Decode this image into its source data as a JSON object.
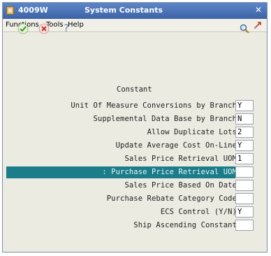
{
  "window": {
    "code": "4009W",
    "title": "System Constants",
    "close_symbol": "✕"
  },
  "menu": {
    "items": [
      "Functions",
      "Tools",
      "Help"
    ]
  },
  "toolbar": {
    "ok_icon": "check-icon",
    "cancel_icon": "cancel-icon",
    "help_label": "?",
    "search_icon": "magnifier-icon"
  },
  "colors": {
    "title_bar": "#4a73b8",
    "selection": "#1b7c8a",
    "background": "#ecebe2"
  },
  "form": {
    "section_title": "Constant",
    "rows": [
      {
        "label": "Unit Of Measure Conversions by Branch",
        "value": "Y"
      },
      {
        "label": "Supplemental Data Base by Branch",
        "value": "N"
      },
      {
        "label": "Allow Duplicate Lots",
        "value": "2"
      },
      {
        "label": "Update Average Cost On-Line",
        "value": "Y"
      },
      {
        "label": "Sales Price Retrieval UOM",
        "value": "1"
      },
      {
        "label": ": Purchase Price Retrieval UOM",
        "value": ""
      },
      {
        "label": "Sales Price Based On Date",
        "value": ""
      },
      {
        "label": "Purchase Rebate Category Code",
        "value": ""
      },
      {
        "label": "ECS Control (Y/N)",
        "value": "Y"
      },
      {
        "label": "Ship Ascending Constant",
        "value": ""
      }
    ]
  }
}
